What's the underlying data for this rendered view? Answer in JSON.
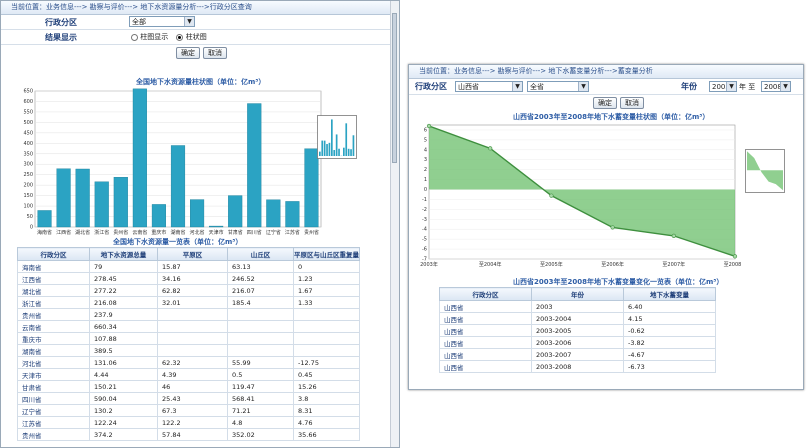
{
  "left": {
    "breadcrumb": "当前位置：业务信息---> 勘察与评价---> 地下水资源量分析--->行政分区查询",
    "form": {
      "region_label": "行政分区",
      "region_value": "全部",
      "display_label": "结果显示",
      "opt_chart_only": "柱图显示",
      "opt_bar": "柱状图",
      "confirm": "确定",
      "cancel": "取消"
    },
    "chart_data": {
      "type": "bar",
      "title": "全国地下水资源量柱状图（单位：亿m³）",
      "categories": [
        "海南省",
        "江西省",
        "湖北省",
        "浙江省",
        "贵州省",
        "云南省",
        "重庆市",
        "湖南省",
        "河北省",
        "天津市",
        "甘肃省",
        "四川省",
        "辽宁省",
        "江苏省",
        "贵州省"
      ],
      "values": [
        79,
        278.45,
        277.22,
        216.08,
        237.9,
        660.34,
        107.88,
        389.5,
        131.06,
        4.44,
        150.21,
        590.04,
        130.2,
        122.24,
        374.2
      ],
      "yticks": [
        "0",
        "50",
        "100",
        "150",
        "200",
        "250",
        "300",
        "350",
        "400",
        "450",
        "500",
        "550",
        "600",
        "650"
      ],
      "ylim": [
        0,
        650
      ],
      "color": "#2ba3c3"
    },
    "table": {
      "title": "全国地下水资源量一览表（单位：亿m³）",
      "headers": [
        "行政分区",
        "地下水资源总量",
        "平原区",
        "山丘区",
        "平原区与山丘区重复量"
      ],
      "rows": [
        [
          "海南省",
          "79",
          "15.87",
          "63.13",
          "0"
        ],
        [
          "江西省",
          "278.45",
          "34.16",
          "246.52",
          "1.23"
        ],
        [
          "湖北省",
          "277.22",
          "62.82",
          "216.07",
          "1.67"
        ],
        [
          "浙江省",
          "216.08",
          "32.01",
          "185.4",
          "1.33"
        ],
        [
          "贵州省",
          "237.9",
          "",
          "",
          ""
        ],
        [
          "云南省",
          "660.34",
          "",
          "",
          ""
        ],
        [
          "重庆市",
          "107.88",
          "",
          "",
          ""
        ],
        [
          "湖南省",
          "389.5",
          "",
          "",
          ""
        ],
        [
          "河北省",
          "131.06",
          "62.32",
          "55.99",
          "-12.75"
        ],
        [
          "天津市",
          "4.44",
          "4.39",
          "0.5",
          "0.45"
        ],
        [
          "甘肃省",
          "150.21",
          "46",
          "119.47",
          "15.26"
        ],
        [
          "四川省",
          "590.04",
          "25.43",
          "568.41",
          "3.8"
        ],
        [
          "辽宁省",
          "130.2",
          "67.3",
          "71.21",
          "8.31"
        ],
        [
          "江苏省",
          "122.24",
          "122.2",
          "4.8",
          "4.76"
        ],
        [
          "贵州省",
          "374.2",
          "57.84",
          "352.02",
          "35.66"
        ]
      ]
    }
  },
  "right": {
    "breadcrumb": "当前位置：业务信息---> 勘察与评价---> 地下水蓄变量分析--->蓄变量分析",
    "form": {
      "region_label": "行政分区",
      "province": "山西省",
      "city": "全省",
      "year_label": "年份",
      "year_from": "2003",
      "year_sep": "年 至",
      "year_to": "2008",
      "confirm": "确定",
      "cancel": "取消"
    },
    "chart_data": {
      "type": "area",
      "title": "山西省2003年至2008年地下水蓄变量柱状图（单位：亿m³）",
      "x": [
        "2003年",
        "至2004年",
        "至2005年",
        "至2006年",
        "至2007年",
        "至2008年"
      ],
      "values": [
        6.4,
        4.15,
        -0.62,
        -3.82,
        -4.67,
        -6.73
      ],
      "yticks": [
        "6",
        "5",
        "4",
        "3",
        "2",
        "1",
        "0",
        "-1",
        "-2",
        "-3",
        "-4",
        "-5",
        "-6",
        "-7"
      ],
      "ylim": [
        -7,
        6.5
      ],
      "color": "#6bbf6b"
    },
    "table": {
      "title": "山西省2003年至2008年地下水蓄变量变化一览表（单位：亿m³）",
      "headers": [
        "行政分区",
        "年份",
        "地下水蓄变量"
      ],
      "rows": [
        [
          "山西省",
          "2003",
          "6.40"
        ],
        [
          "山西省",
          "2003-2004",
          "4.15"
        ],
        [
          "山西省",
          "2003-2005",
          "-0.62"
        ],
        [
          "山西省",
          "2003-2006",
          "-3.82"
        ],
        [
          "山西省",
          "2003-2007",
          "-4.67"
        ],
        [
          "山西省",
          "2003-2008",
          "-6.73"
        ]
      ]
    }
  }
}
